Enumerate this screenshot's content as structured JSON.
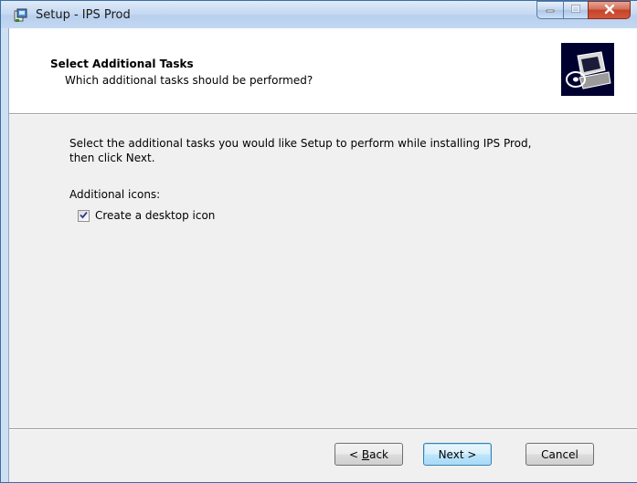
{
  "window": {
    "title": "Setup - IPS Prod",
    "icons": {
      "app": "setup-installer-icon",
      "minimize": "minimize-icon",
      "maximize": "maximize-icon",
      "close": "close-icon"
    },
    "colors": {
      "close_button": "#c3432a",
      "title_bar": "#c6daf2"
    }
  },
  "header": {
    "title": "Select Additional Tasks",
    "subtitle": "Which additional tasks should be performed?",
    "image_icon": "computer-disc-icon"
  },
  "body": {
    "instructions_line1": "Select the additional tasks you would like Setup to perform while installing IPS Prod,",
    "instructions_line2": "then click Next.",
    "group_label": "Additional icons:",
    "tasks": [
      {
        "label": "Create a desktop icon",
        "checked": true
      }
    ]
  },
  "buttons": {
    "back_prefix": "< ",
    "back_accel": "B",
    "back_rest": "ack",
    "next": "Next >",
    "cancel": "Cancel"
  }
}
